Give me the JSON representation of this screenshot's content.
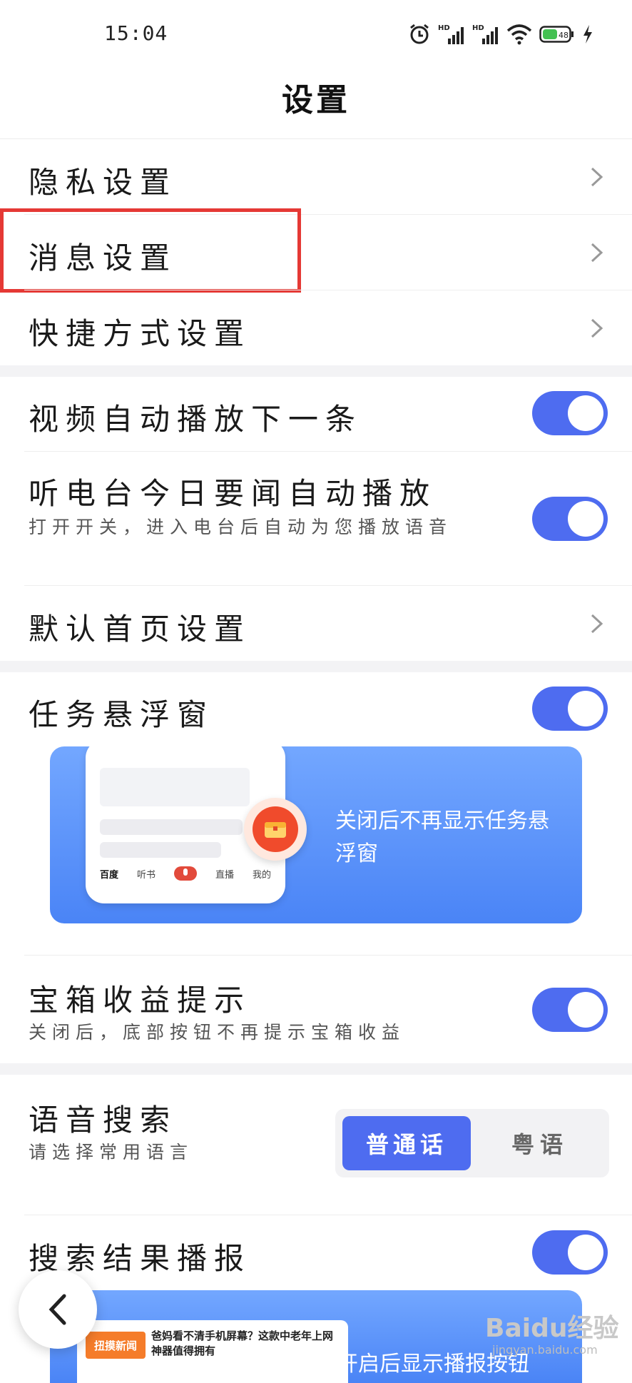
{
  "status_bar": {
    "time": "15:04",
    "icons": [
      "alarm-icon",
      "hd-signal-icon",
      "hd-signal-icon",
      "wifi-icon",
      "battery-icon",
      "charging-icon"
    ],
    "hd_label": "HD",
    "battery_level": "48"
  },
  "header": {
    "title": "设置"
  },
  "rows": {
    "privacy": {
      "label": "隐私设置"
    },
    "message": {
      "label": "消息设置"
    },
    "shortcut": {
      "label": "快捷方式设置"
    },
    "video_autoplay": {
      "label": "视频自动播放下一条",
      "on": true
    },
    "radio_autoplay": {
      "label": "听电台今日要闻自动播放",
      "sub": "打开开关，进入电台后自动为您播放语音",
      "on": true
    },
    "default_home": {
      "label": "默认首页设置"
    },
    "task_float": {
      "label": "任务悬浮窗",
      "on": true
    },
    "chest_tip": {
      "label": "宝箱收益提示",
      "sub": "关闭后，底部按钮不再提示宝箱收益",
      "on": true
    },
    "voice_search": {
      "label": "语音搜索",
      "sub": "请选择常用语言",
      "options": [
        "普通话",
        "粤语"
      ],
      "selected": "普通话"
    },
    "search_broadcast": {
      "label": "搜索结果播报",
      "on": true
    }
  },
  "task_banner": {
    "text": "关闭后不再显示任务悬浮窗",
    "phone_tabs": [
      "百度",
      "听书",
      "直播",
      "我的"
    ]
  },
  "broadcast_banner": {
    "text": "开启后显示播报按钮",
    "news_tag": "扭摸新闻",
    "news_title": "爸妈看不清手机屏幕？这款中老年上网神器值得拥有"
  },
  "watermark": {
    "brand": "Baidu经验",
    "url": "jingyan.baidu.com"
  },
  "colors": {
    "accent": "#4e6cf0",
    "highlight": "#e53935"
  }
}
